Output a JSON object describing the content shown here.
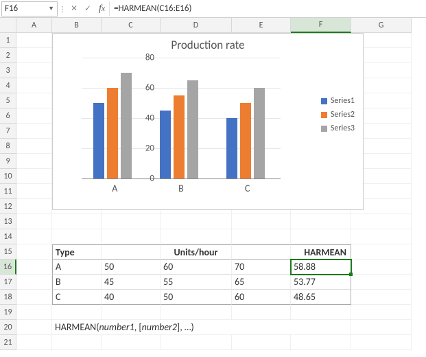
{
  "formula_bar": {
    "cell_ref": "F16",
    "formula": "=HARMEAN(C16:E16)"
  },
  "columns": [
    "A",
    "B",
    "C",
    "D",
    "E",
    "F",
    "G"
  ],
  "rows": [
    "1",
    "2",
    "3",
    "4",
    "5",
    "6",
    "7",
    "8",
    "9",
    "10",
    "11",
    "12",
    "13",
    "14",
    "15",
    "16",
    "17",
    "18",
    "19",
    "20",
    "21"
  ],
  "active": {
    "col": "F",
    "row": "16"
  },
  "table": {
    "headers": {
      "type": "Type",
      "units": "Units/hour",
      "harm": "HARMEAN"
    },
    "rows": [
      {
        "type": "A",
        "v1": "50",
        "v2": "60",
        "v3": "70",
        "harm": "58.88"
      },
      {
        "type": "B",
        "v1": "45",
        "v2": "55",
        "v3": "65",
        "harm": "53.77"
      },
      {
        "type": "C",
        "v1": "40",
        "v2": "50",
        "v3": "60",
        "harm": "48.65"
      }
    ]
  },
  "syntax": {
    "fn": "HARMEAN(",
    "a1": "number1",
    "sep1": " , [",
    "a2": "number2",
    "end": " ], …)"
  },
  "chart_data": {
    "type": "bar",
    "title": "Production rate",
    "categories": [
      "A",
      "B",
      "C"
    ],
    "series": [
      {
        "name": "Series1",
        "values": [
          50,
          45,
          40
        ]
      },
      {
        "name": "Series2",
        "values": [
          60,
          55,
          50
        ]
      },
      {
        "name": "Series3",
        "values": [
          70,
          65,
          60
        ]
      }
    ],
    "xlabel": "",
    "ylabel": "",
    "ylim": [
      0,
      80
    ],
    "yticks": [
      0,
      20,
      40,
      60,
      80
    ],
    "legend_position": "right",
    "colors": {
      "Series1": "#4472c4",
      "Series2": "#ed7d31",
      "Series3": "#a5a5a5"
    }
  }
}
